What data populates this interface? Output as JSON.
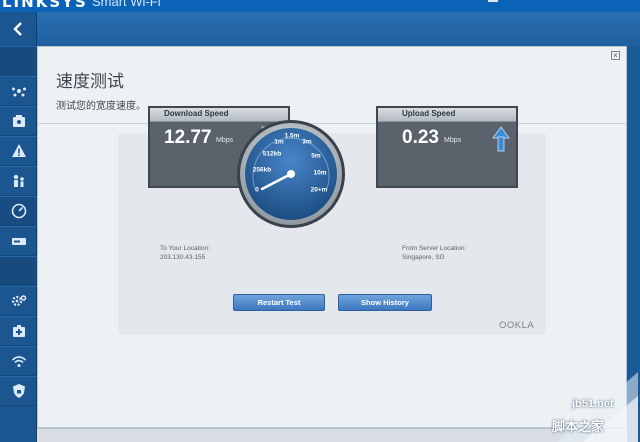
{
  "header": {
    "brand": "LINKSYS",
    "product": "Smart Wi-Fi"
  },
  "sidebar": {
    "back_label": "<",
    "items": [
      {
        "icon": "network-map-icon"
      },
      {
        "icon": "guest-access-icon"
      },
      {
        "icon": "alert-icon"
      },
      {
        "icon": "parental-controls-icon"
      },
      {
        "icon": "speed-test-icon",
        "active": true
      },
      {
        "icon": "external-storage-icon"
      },
      {
        "icon": "connectivity-settings-icon"
      },
      {
        "icon": "troubleshooting-icon"
      },
      {
        "icon": "wireless-icon"
      },
      {
        "icon": "security-icon"
      }
    ]
  },
  "window": {
    "close_label": "×",
    "title": "速度测试",
    "subtitle": "测试您的宽度速度。"
  },
  "download": {
    "title": "Download Speed",
    "value": "12.77",
    "unit": "Mbps",
    "location_label": "To Your Location:",
    "location_value": "203.130.43.155"
  },
  "upload": {
    "title": "Upload Speed",
    "value": "0.23",
    "unit": "Mbps",
    "location_label": "From Server Location:",
    "location_value": "Singapore, SG"
  },
  "gauge": {
    "labels": [
      "0",
      "256kb",
      "512kb",
      "1m",
      "1.5m",
      "3m",
      "5m",
      "10m",
      "20+m"
    ],
    "needle_label_value": "5m"
  },
  "buttons": {
    "restart": "Restart Test",
    "history": "Show History"
  },
  "footer": {
    "provider": "OOKLA"
  },
  "watermark": {
    "url": "jb51.net",
    "text": "脚本之家"
  },
  "colors": {
    "header_blue": "#0a63b6",
    "sidebar_blue": "#1b5690",
    "button_blue": "#3d78c0",
    "arrow_blue": "#3b8ad8"
  }
}
